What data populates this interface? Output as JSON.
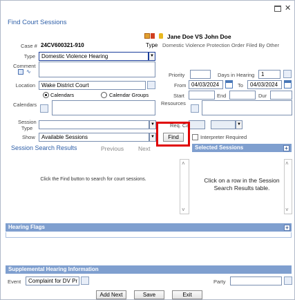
{
  "window": {
    "title": "Find Court Sessions"
  },
  "header": {
    "case_label": "Case #",
    "case_number": "24CV600321-910",
    "case_name": "Jane Doe VS John Doe",
    "type_label": "Type",
    "type_value": "Domestic Violence Protection Order Filed By Other"
  },
  "form": {
    "type_label": "Type",
    "type_value": "Domestic Violence Hearing",
    "comment_label": "Comment",
    "location_label": "Location",
    "location_value": "Wake District Court",
    "radio_calendars": "Calendars",
    "radio_calendar_groups": "Calendar Groups",
    "calendars_label": "Calendars",
    "session_type_label": "Session Type",
    "show_label": "Show",
    "show_value": "Available Sessions",
    "priority_label": "Priority",
    "days_label": "Days in Hearing",
    "days_value": "1",
    "from_label": "From",
    "from_value": "04/03/2024",
    "to_label": "To",
    "to_value": "04/03/2024",
    "start_label": "Start",
    "end_label": "End",
    "dur_label": "Dur",
    "resources_label": "Resources",
    "req_cap_label": "Req. Cap",
    "interpreter_label": "Interpreter Required",
    "find_button": "Find"
  },
  "results": {
    "title": "Session Search Results",
    "previous": "Previous",
    "next": "Next",
    "empty_message": "Click the Find button to search for court sessions."
  },
  "selected": {
    "title": "Selected Sessions",
    "empty_message": "Click on a row in the Session Search Results table."
  },
  "hearing_flags": {
    "title": "Hearing Flags"
  },
  "supplemental": {
    "title": "Supplemental Hearing Information",
    "event_label": "Event",
    "event_value": "Complaint for DV Pr",
    "party_label": "Party"
  },
  "footer": {
    "add_next": "Add Next",
    "save": "Save",
    "exit": "Exit"
  },
  "colors": {
    "section_bar": "#7f9fcf",
    "title_text": "#2e5fa8",
    "highlight_box": "#e00000"
  }
}
